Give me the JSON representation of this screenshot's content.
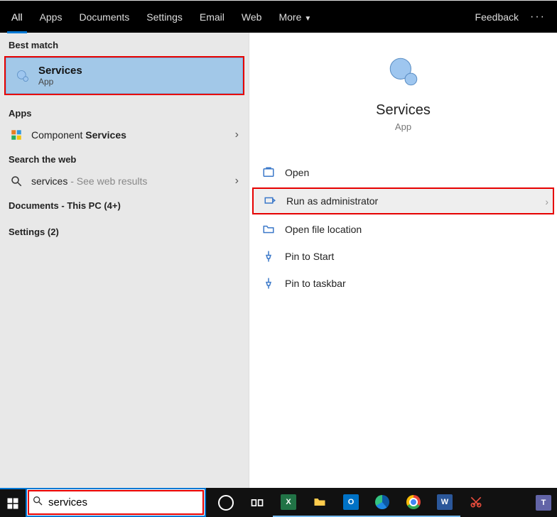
{
  "tabs": {
    "items": [
      "All",
      "Apps",
      "Documents",
      "Settings",
      "Email",
      "Web",
      "More"
    ],
    "active": 0,
    "feedback": "Feedback"
  },
  "left": {
    "best_match_header": "Best match",
    "best_match": {
      "title": "Services",
      "sub": "App"
    },
    "apps_header": "Apps",
    "apps_item": {
      "prefix": "Component ",
      "bold": "Services"
    },
    "search_web_header": "Search the web",
    "web_item": {
      "term": "services",
      "hint": " - See web results"
    },
    "documents_header": "Documents - This PC (4+)",
    "settings_header": "Settings (2)"
  },
  "preview": {
    "title": "Services",
    "sub": "App",
    "actions": {
      "open": "Open",
      "runadmin": "Run as administrator",
      "openloc": "Open file location",
      "pinstart": "Pin to Start",
      "pintask": "Pin to taskbar"
    }
  },
  "taskbar": {
    "search_value": "services"
  }
}
